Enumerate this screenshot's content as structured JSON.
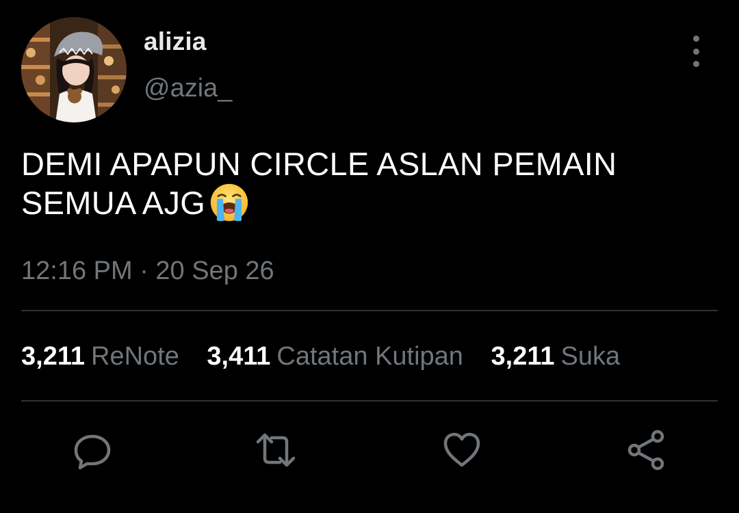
{
  "tweet": {
    "author": {
      "display_name": "alizia",
      "handle": "@azia_",
      "avatar_icon": "profile-photo"
    },
    "text_lines": [
      "DEMI APAPUN CIRCLE ASLAN PEMAIN",
      "SEMUA AJG"
    ],
    "emoji": "loudly-crying-face",
    "timestamp": "12:16 PM · 20 Sep 26"
  },
  "stats": [
    {
      "count": "3,211",
      "label": "ReNote"
    },
    {
      "count": "3,411",
      "label": "Catatan Kutipan"
    },
    {
      "count": "3,211",
      "label": "Suka"
    }
  ],
  "actions": [
    {
      "icon": "reply-icon"
    },
    {
      "icon": "renote-icon"
    },
    {
      "icon": "like-icon"
    },
    {
      "icon": "share-icon"
    }
  ],
  "colors": {
    "background": "#000000",
    "primary_text": "#ffffff",
    "secondary_text": "#71767b",
    "divider": "#2f3336"
  }
}
